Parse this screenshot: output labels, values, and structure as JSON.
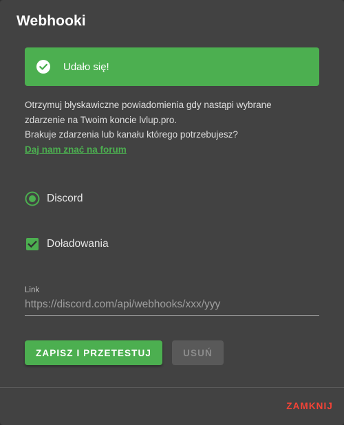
{
  "dialog": {
    "title": "Webhooki"
  },
  "alert": {
    "text": "Udało się!",
    "icon": "check-circle-icon",
    "color": "#4caf50"
  },
  "description": {
    "line1": "Otrzymuj błyskawiczne powiadomienia gdy nastąpi wybrane",
    "line2": "zdarzenie na Twoim koncie lvlup.pro.",
    "line3": "Brakuje zdarzenia lub kanału którego potrzebujesz?",
    "link": "Daj nam znać na forum"
  },
  "channel": {
    "label": "Discord",
    "selected": true
  },
  "events": {
    "recharge_label": "Doładowania",
    "recharge_checked": true
  },
  "link_field": {
    "label": "Link",
    "placeholder": "https://discord.com/api/webhooks/xxx/yyy",
    "value": ""
  },
  "actions": {
    "save_label": "ZAPISZ I PRZETESTUJ",
    "delete_label": "USUŃ",
    "close_label": "ZAMKNIJ"
  },
  "colors": {
    "accent": "#4caf50",
    "danger": "#f44336",
    "surface": "#424242"
  }
}
